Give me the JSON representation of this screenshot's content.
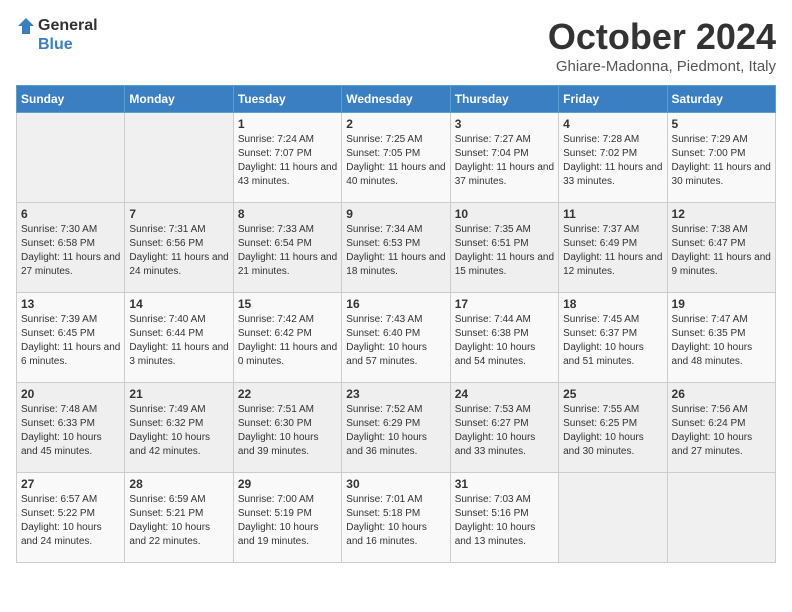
{
  "header": {
    "logo_general": "General",
    "logo_blue": "Blue",
    "month_title": "October 2024",
    "location": "Ghiare-Madonna, Piedmont, Italy"
  },
  "weekdays": [
    "Sunday",
    "Monday",
    "Tuesday",
    "Wednesday",
    "Thursday",
    "Friday",
    "Saturday"
  ],
  "weeks": [
    [
      {
        "day": "",
        "content": ""
      },
      {
        "day": "",
        "content": ""
      },
      {
        "day": "1",
        "content": "Sunrise: 7:24 AM\nSunset: 7:07 PM\nDaylight: 11 hours and 43 minutes."
      },
      {
        "day": "2",
        "content": "Sunrise: 7:25 AM\nSunset: 7:05 PM\nDaylight: 11 hours and 40 minutes."
      },
      {
        "day": "3",
        "content": "Sunrise: 7:27 AM\nSunset: 7:04 PM\nDaylight: 11 hours and 37 minutes."
      },
      {
        "day": "4",
        "content": "Sunrise: 7:28 AM\nSunset: 7:02 PM\nDaylight: 11 hours and 33 minutes."
      },
      {
        "day": "5",
        "content": "Sunrise: 7:29 AM\nSunset: 7:00 PM\nDaylight: 11 hours and 30 minutes."
      }
    ],
    [
      {
        "day": "6",
        "content": "Sunrise: 7:30 AM\nSunset: 6:58 PM\nDaylight: 11 hours and 27 minutes."
      },
      {
        "day": "7",
        "content": "Sunrise: 7:31 AM\nSunset: 6:56 PM\nDaylight: 11 hours and 24 minutes."
      },
      {
        "day": "8",
        "content": "Sunrise: 7:33 AM\nSunset: 6:54 PM\nDaylight: 11 hours and 21 minutes."
      },
      {
        "day": "9",
        "content": "Sunrise: 7:34 AM\nSunset: 6:53 PM\nDaylight: 11 hours and 18 minutes."
      },
      {
        "day": "10",
        "content": "Sunrise: 7:35 AM\nSunset: 6:51 PM\nDaylight: 11 hours and 15 minutes."
      },
      {
        "day": "11",
        "content": "Sunrise: 7:37 AM\nSunset: 6:49 PM\nDaylight: 11 hours and 12 minutes."
      },
      {
        "day": "12",
        "content": "Sunrise: 7:38 AM\nSunset: 6:47 PM\nDaylight: 11 hours and 9 minutes."
      }
    ],
    [
      {
        "day": "13",
        "content": "Sunrise: 7:39 AM\nSunset: 6:45 PM\nDaylight: 11 hours and 6 minutes."
      },
      {
        "day": "14",
        "content": "Sunrise: 7:40 AM\nSunset: 6:44 PM\nDaylight: 11 hours and 3 minutes."
      },
      {
        "day": "15",
        "content": "Sunrise: 7:42 AM\nSunset: 6:42 PM\nDaylight: 11 hours and 0 minutes."
      },
      {
        "day": "16",
        "content": "Sunrise: 7:43 AM\nSunset: 6:40 PM\nDaylight: 10 hours and 57 minutes."
      },
      {
        "day": "17",
        "content": "Sunrise: 7:44 AM\nSunset: 6:38 PM\nDaylight: 10 hours and 54 minutes."
      },
      {
        "day": "18",
        "content": "Sunrise: 7:45 AM\nSunset: 6:37 PM\nDaylight: 10 hours and 51 minutes."
      },
      {
        "day": "19",
        "content": "Sunrise: 7:47 AM\nSunset: 6:35 PM\nDaylight: 10 hours and 48 minutes."
      }
    ],
    [
      {
        "day": "20",
        "content": "Sunrise: 7:48 AM\nSunset: 6:33 PM\nDaylight: 10 hours and 45 minutes."
      },
      {
        "day": "21",
        "content": "Sunrise: 7:49 AM\nSunset: 6:32 PM\nDaylight: 10 hours and 42 minutes."
      },
      {
        "day": "22",
        "content": "Sunrise: 7:51 AM\nSunset: 6:30 PM\nDaylight: 10 hours and 39 minutes."
      },
      {
        "day": "23",
        "content": "Sunrise: 7:52 AM\nSunset: 6:29 PM\nDaylight: 10 hours and 36 minutes."
      },
      {
        "day": "24",
        "content": "Sunrise: 7:53 AM\nSunset: 6:27 PM\nDaylight: 10 hours and 33 minutes."
      },
      {
        "day": "25",
        "content": "Sunrise: 7:55 AM\nSunset: 6:25 PM\nDaylight: 10 hours and 30 minutes."
      },
      {
        "day": "26",
        "content": "Sunrise: 7:56 AM\nSunset: 6:24 PM\nDaylight: 10 hours and 27 minutes."
      }
    ],
    [
      {
        "day": "27",
        "content": "Sunrise: 6:57 AM\nSunset: 5:22 PM\nDaylight: 10 hours and 24 minutes."
      },
      {
        "day": "28",
        "content": "Sunrise: 6:59 AM\nSunset: 5:21 PM\nDaylight: 10 hours and 22 minutes."
      },
      {
        "day": "29",
        "content": "Sunrise: 7:00 AM\nSunset: 5:19 PM\nDaylight: 10 hours and 19 minutes."
      },
      {
        "day": "30",
        "content": "Sunrise: 7:01 AM\nSunset: 5:18 PM\nDaylight: 10 hours and 16 minutes."
      },
      {
        "day": "31",
        "content": "Sunrise: 7:03 AM\nSunset: 5:16 PM\nDaylight: 10 hours and 13 minutes."
      },
      {
        "day": "",
        "content": ""
      },
      {
        "day": "",
        "content": ""
      }
    ]
  ]
}
